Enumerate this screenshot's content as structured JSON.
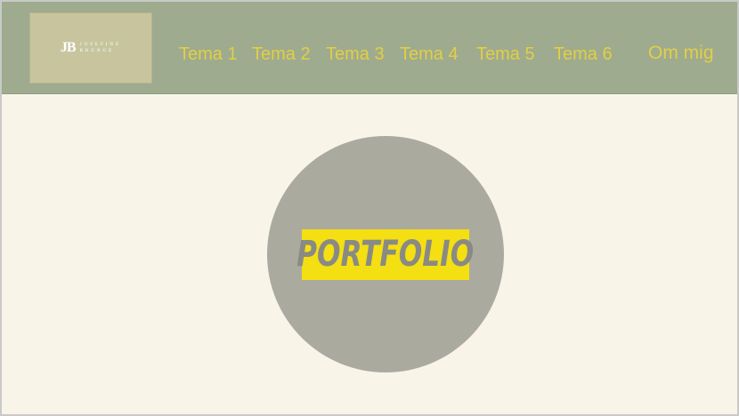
{
  "header": {
    "logo": {
      "monogram": "JB",
      "name_line1": "JOSEFINE",
      "name_line2": "BRUNGE"
    },
    "nav": [
      {
        "label": "Tema 1"
      },
      {
        "label": "Tema 2"
      },
      {
        "label": "Tema 3"
      },
      {
        "label": "Tema 4"
      },
      {
        "label": "Tema 5"
      },
      {
        "label": "Tema 6"
      }
    ],
    "about_label": "Om mig"
  },
  "hero": {
    "badge_text": "PORTFOLIO"
  },
  "colors": {
    "header_bg": "#9eab8e",
    "page_bg": "#f8f5e8",
    "nav_text": "#e3cf45",
    "circle": "#aaaa9f",
    "badge": "#f3df12",
    "badge_text": "#8a8a84"
  }
}
